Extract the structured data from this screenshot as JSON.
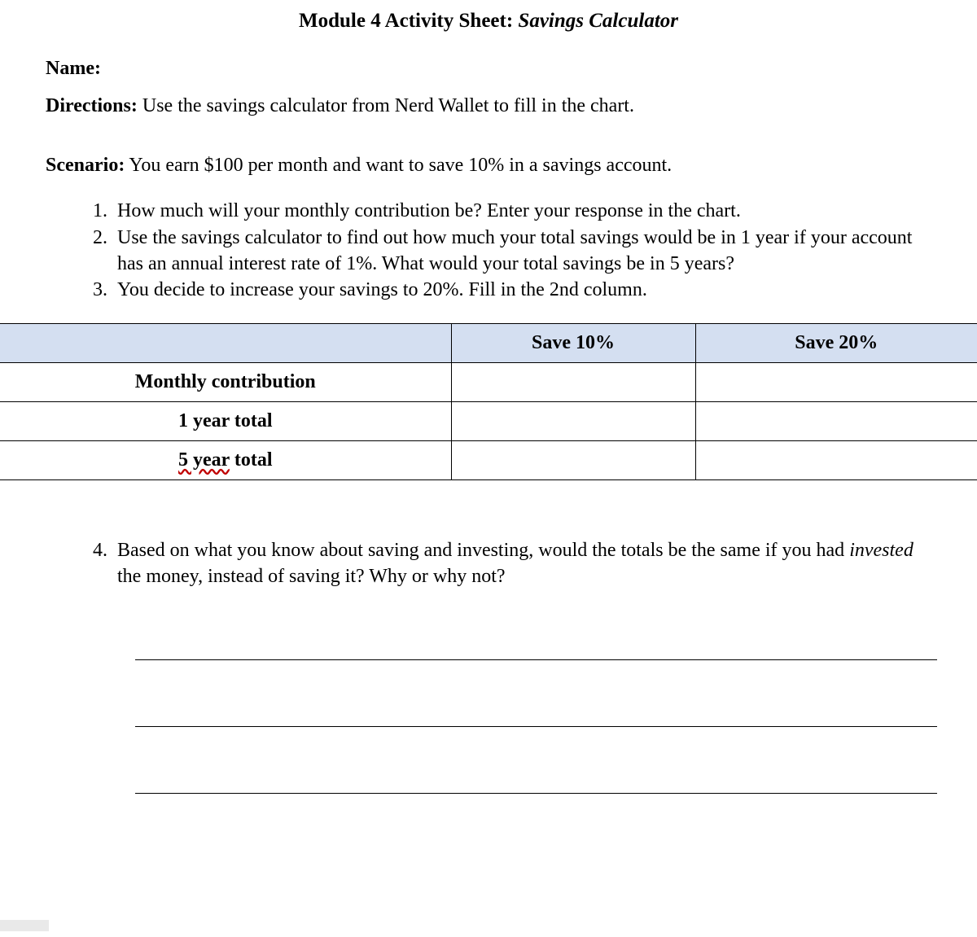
{
  "title": {
    "prefix": "Module 4 Activity Sheet: ",
    "suffix": "Savings Calculator"
  },
  "name": {
    "label": "Name:",
    "value": ""
  },
  "directions": {
    "label": "Directions:",
    "text": " Use the savings calculator from Nerd Wallet to fill in the chart."
  },
  "scenario": {
    "label": "Scenario:",
    "text": " You earn $100 per month and want to save 10% in a savings account."
  },
  "questions": {
    "q1": "How much will your monthly contribution be? Enter your response in the chart.",
    "q2": "Use the savings calculator to find out how much your total savings would be in 1 year if your account has an annual interest rate of 1%. What would your total savings be in 5 years?",
    "q3": "You decide to increase your savings to 20%. Fill in the 2nd column."
  },
  "table": {
    "headers": {
      "blank": "",
      "col_a": "Save 10%",
      "col_b": "Save 20%"
    },
    "rows": {
      "r1": {
        "label": "Monthly contribution",
        "a": "",
        "b": ""
      },
      "r2": {
        "label": "1 year total",
        "a": "",
        "b": ""
      },
      "r3": {
        "label_prefix": "5 year",
        "label_suffix": " total",
        "a": "",
        "b": ""
      }
    }
  },
  "q4": {
    "pre": "Based on what you know about saving and investing, would the totals be the same if you had ",
    "ital": "invested",
    "post": " the money, instead of saving it? Why or why not?"
  },
  "answers": {
    "l1": "",
    "l2": "",
    "l3": ""
  }
}
